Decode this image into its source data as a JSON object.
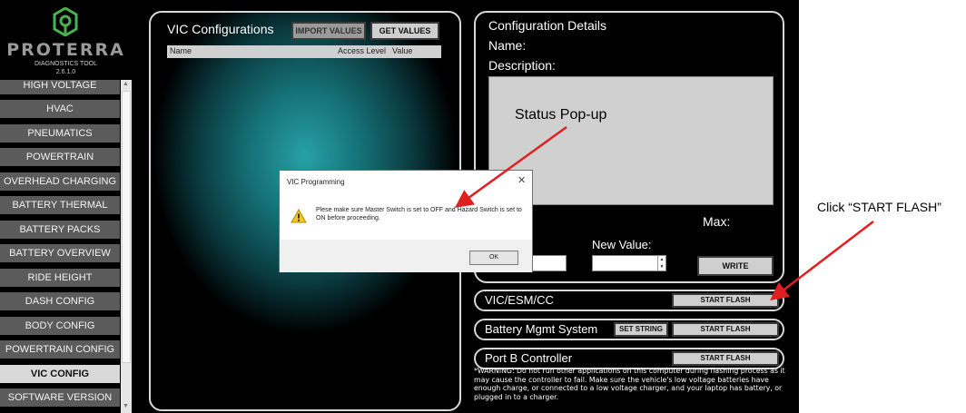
{
  "brand": {
    "wordmark": "PROTERRA",
    "subtitle": "DIAGNOSTICS TOOL",
    "version": "2.6.1.0",
    "accent_color": "#4caf50"
  },
  "sidebar": {
    "items": [
      {
        "label": "HIGH VOLTAGE"
      },
      {
        "label": "HVAC"
      },
      {
        "label": "PNEUMATICS"
      },
      {
        "label": "POWERTRAIN"
      },
      {
        "label": "OVERHEAD CHARGING"
      },
      {
        "label": "BATTERY THERMAL"
      },
      {
        "label": "BATTERY PACKS"
      },
      {
        "label": "BATTERY OVERVIEW"
      },
      {
        "label": "RIDE HEIGHT"
      },
      {
        "label": "DASH CONFIG"
      },
      {
        "label": "BODY CONFIG"
      },
      {
        "label": "POWERTRAIN CONFIG"
      },
      {
        "label": "VIC CONFIG",
        "active": true
      },
      {
        "label": "SOFTWARE VERSION"
      }
    ]
  },
  "vic_panel": {
    "title": "VIC Configurations",
    "import_label": "IMPORT VALUES",
    "get_label": "GET VALUES",
    "columns": [
      "Name",
      "Access Level",
      "Value"
    ]
  },
  "details": {
    "title": "Configuration Details",
    "name_label": "Name:",
    "description_label": "Description:",
    "max_label": "Max:",
    "new_value_label": "New Value:",
    "write_label": "WRITE"
  },
  "flash_rows": [
    {
      "name": "VIC/ESM/CC",
      "button": "START FLASH"
    },
    {
      "name": "Battery Mgmt System",
      "extra_button": "SET STRING",
      "button": "START FLASH"
    },
    {
      "name": "Port B Controller",
      "button": "START FLASH"
    }
  ],
  "warning": "*WARNING: Do not run other applications on this computer during flashing process as it may cause the controller to fail. Make sure the vehicle's low voltage batteries have enough charge, or connected to a low voltage charger, and your laptop has battery, or plugged in to a charger.",
  "dialog": {
    "title": "VIC Programming",
    "close_glyph": "✕",
    "message": "Plese make sure Master Switch is set to OFF and Hazard Switch is set to ON before proceeding.",
    "ok_label": "OK",
    "icon": "warning-icon"
  },
  "annotations": {
    "status_popup": "Status Pop-up",
    "click_start_flash": "Click “START FLASH”",
    "arrow_color": "#e02020"
  }
}
